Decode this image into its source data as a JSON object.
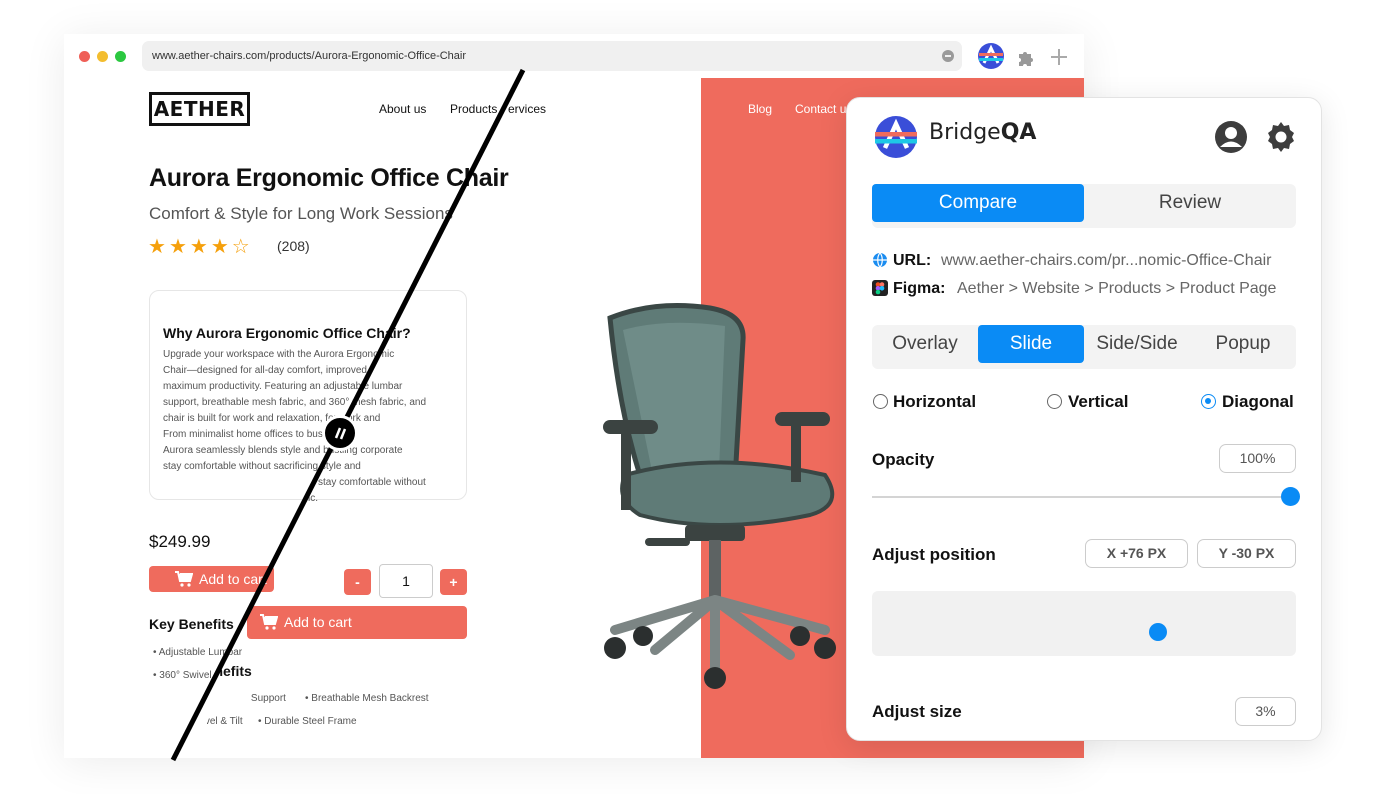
{
  "browser": {
    "url": "www.aether-chairs.com/products/Aurora-Ergonomic-Office-Chair",
    "traffic_colors": [
      "#ef5f57",
      "#f3bd2f",
      "#2bc840"
    ]
  },
  "site": {
    "logo": "AETHER",
    "nav": [
      "About us",
      "Products",
      "Services",
      "Blog",
      "Contact us"
    ],
    "product_title": "Aurora Ergonomic Office Chair",
    "subtitle": "Comfort & Style for Long Work Sessions",
    "rating": 4,
    "rating_max": 5,
    "review_count": "(208)",
    "card_title": "Why Aurora Ergonomic Office Chair?",
    "card_lines": [
      "Upgrade your workspace with the Aurora Ergonomic",
      "Chair—designed for all-day comfort, improved",
      "maximum productivity. Featuring an adjustable lumbar",
      "support, breathable mesh fabric, and 360° mesh fabric, and",
      "chair is built for work and relaxation, for work and",
      "From minimalist home offices to bustling",
      "Aurora seamlessly blends style and bustling corporate",
      "stay comfortable without sacrificing style and",
      "stay comfortable without",
      "ic."
    ],
    "price": "$249.99",
    "add_to_cart": "Add to cart",
    "qty_minus": "-",
    "qty_value": "1",
    "qty_plus": "+",
    "key_benefits": "Key Benefits",
    "key_benefits_shifted": "Key Benefits",
    "benefits": [
      "Adjustable Lumbar",
      "360° Swivel",
      "Adjustable Lumbar Support",
      "Breathable Mesh Backrest",
      "360° Swivel & Tilt",
      "Durable Steel Frame"
    ],
    "accent": "#ef6b5d"
  },
  "bridgeqa": {
    "brand_regular": "Bridge",
    "brand_bold": "QA",
    "main_tabs": [
      "Compare",
      "Review"
    ],
    "active_main_tab": "Compare",
    "url_label": "URL:",
    "url_value": "www.aether-chairs.com/pr...nomic-Office-Chair",
    "figma_label": "Figma:",
    "figma_value": "Aether > Website > Products > Product Page",
    "modes": [
      "Overlay",
      "Slide",
      "Side/Side",
      "Popup"
    ],
    "active_mode": "Slide",
    "directions": [
      "Horizontal",
      "Vertical",
      "Diagonal"
    ],
    "selected_direction": "Diagonal",
    "opacity_label": "Opacity",
    "opacity_value": "100%",
    "opacity_level": 1.0,
    "position_label": "Adjust position",
    "pos_x": "X +76 PX",
    "pos_y": "Y -30 PX",
    "size_label": "Adjust size",
    "size_value": "3%",
    "accent": "#0a8bf5"
  }
}
